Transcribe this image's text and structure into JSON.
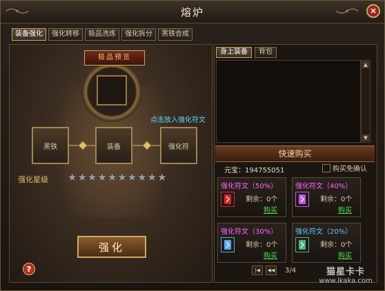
{
  "window": {
    "title": "熔炉",
    "close_icon": "close-x-icon"
  },
  "tabs": [
    {
      "label": "装备强化",
      "active": true
    },
    {
      "label": "强化转移",
      "active": false
    },
    {
      "label": "极品洗炼",
      "active": false
    },
    {
      "label": "强化拆分",
      "active": false
    },
    {
      "label": "黑铁合成",
      "active": false
    }
  ],
  "forge": {
    "quality_label": "极品预览",
    "hint": "点击放入强化符文",
    "slots": {
      "iron": "黑铁",
      "equipment": "装备",
      "rune": "强化符"
    },
    "star_label": "强化星级",
    "star_count": 10,
    "enhance_button": "强化",
    "help_icon": "?"
  },
  "inventory": {
    "tabs": [
      {
        "label": "身上装备",
        "active": true
      },
      {
        "label": "背包",
        "active": false
      }
    ],
    "scroll_up_icon": "▲",
    "scroll_down_icon": "▼"
  },
  "quick_buy": {
    "header": "快速购买",
    "ingot": "元宝：194755051",
    "confirm_label": "购买免确认",
    "items": [
      {
        "name": "强化符文（50%）",
        "color": "#ff66ff",
        "icon_color": "#d02828",
        "remaining": "剩余：0个",
        "buy": "购买"
      },
      {
        "name": "强化符文（40%）",
        "color": "#ff66ff",
        "icon_color": "#c058e0",
        "remaining": "剩余：0个",
        "buy": "购买"
      },
      {
        "name": "强化符文（30%）",
        "color": "#ff66ff",
        "icon_color": "#5aa8e8",
        "remaining": "剩余：0个",
        "buy": "购买"
      },
      {
        "name": "强化符文（20%）",
        "color": "#5fc8ff",
        "icon_color": "#50b080",
        "remaining": "剩余：0个",
        "buy": "购买"
      }
    ],
    "page": "3/4"
  },
  "watermark": {
    "brand": "猫星卡卡",
    "url": "www.ikaka.com"
  }
}
